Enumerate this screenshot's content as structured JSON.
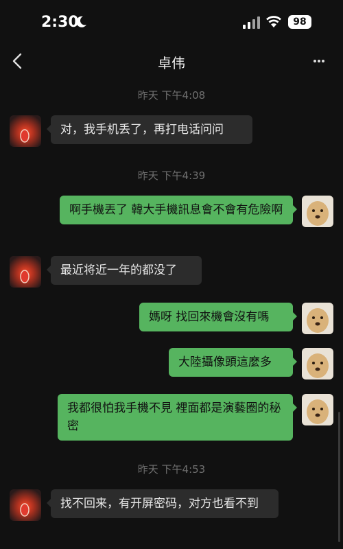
{
  "status": {
    "time": "2:30",
    "battery": "98"
  },
  "header": {
    "title": "卓伟"
  },
  "chat": {
    "timestamps": [
      "昨天 下午4:08",
      "昨天 下午4:39",
      "昨天 下午4:53"
    ],
    "messages": [
      {
        "side": "in",
        "text": "对，我手机丢了，再打电话问问"
      },
      {
        "side": "out",
        "text": "啊手機丟了 韓大手機訊息會不會有危險啊"
      },
      {
        "side": "in",
        "text": "最近将近一年的都没了"
      },
      {
        "side": "out",
        "text": "媽呀 找回來機會沒有嗎"
      },
      {
        "side": "out",
        "text": "大陸攝像頭這麼多"
      },
      {
        "side": "out",
        "text": "我都很怕我手機不見 裡面都是演藝圈的秘密"
      },
      {
        "side": "in",
        "text": "找不回来，有开屏密码，对方也看不到"
      }
    ]
  },
  "colors": {
    "background": "#111111",
    "incoming_bubble": "#2c2c2c",
    "outgoing_bubble": "#56b45f"
  },
  "icons": {
    "back": "chevron-left-icon",
    "more": "more-dots-icon",
    "moon": "moon-icon",
    "wifi": "wifi-icon"
  }
}
